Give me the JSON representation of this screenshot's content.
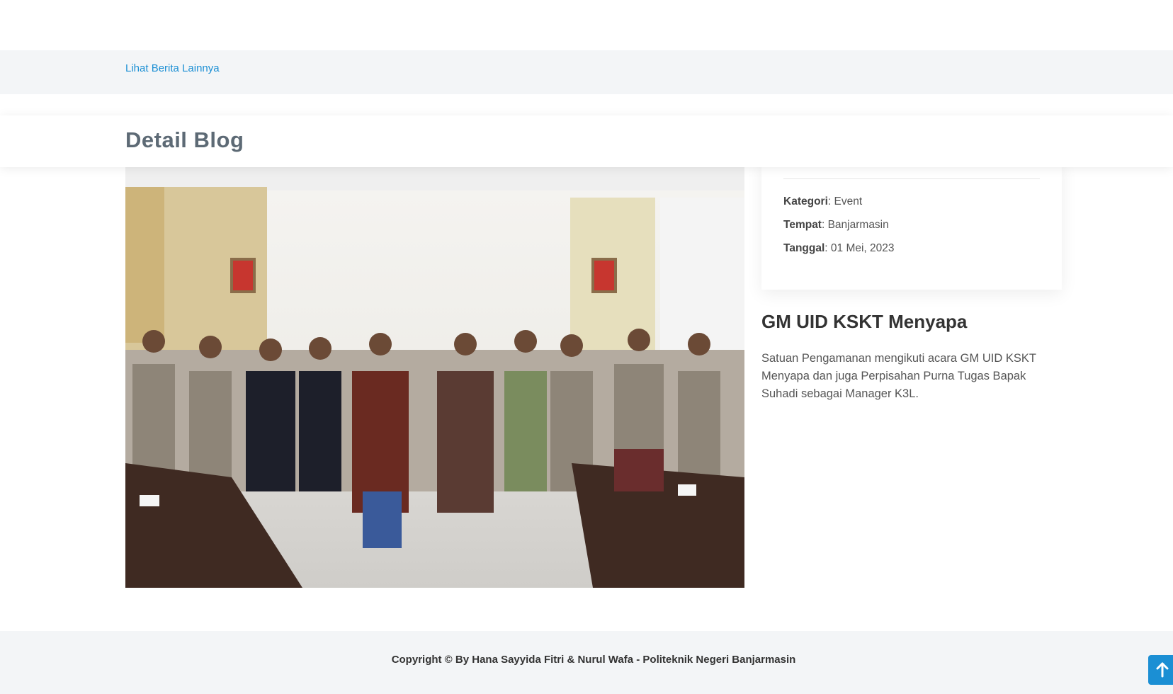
{
  "breadcrumbs": {
    "link_label": "Lihat Berita Lainnya"
  },
  "section": {
    "title": "Detail Blog"
  },
  "info": {
    "category_label": "Kategori",
    "category_value": ": Event",
    "place_label": "Tempat",
    "place_value": ": Banjarmasin",
    "date_label": "Tanggal",
    "date_value": ": 01 Mei, 2023"
  },
  "post": {
    "title": "GM UID KSKT Menyapa",
    "body": "Satuan Pengamanan mengikuti acara GM UID KSKT Menyapa dan juga Perpisahan Purna Tugas Bapak Suhadi sebagai Manager K3L."
  },
  "footer": {
    "copyright": "Copyright © By Hana Sayyida Fitri & Nurul Wafa - Politeknik Negeri Banjarmasin"
  },
  "icons": {
    "back_to_top": "arrow-up-icon"
  },
  "colors": {
    "accent": "#1b8fd4",
    "heading": "#5d6a75",
    "band": "#f3f5f7"
  }
}
